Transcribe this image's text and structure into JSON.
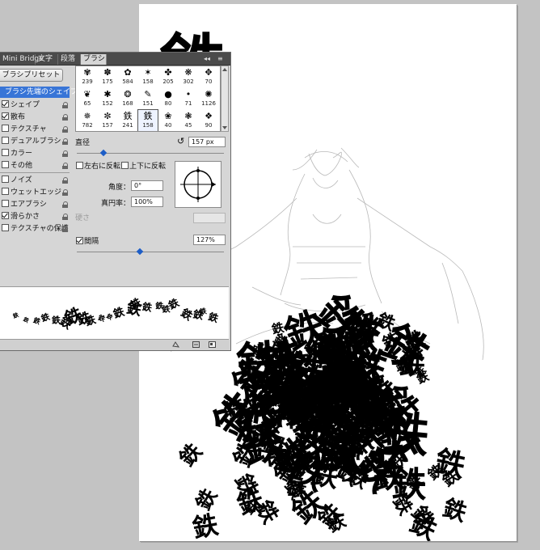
{
  "panel": {
    "tabs": [
      {
        "label": "Mini Bridge",
        "active": false
      },
      {
        "label": "文字",
        "active": false
      },
      {
        "label": "段落",
        "active": false
      },
      {
        "label": "ブラシ",
        "active": true
      }
    ],
    "collapse_icon": "double-chevron-left-icon",
    "menu_icon": "panel-menu-icon",
    "presets_button": "ブラシプリセット",
    "options": [
      {
        "label": "ブラシ先端のシェイプ",
        "checkbox": false,
        "checked": false,
        "selected": true,
        "lock": false
      },
      {
        "label": "シェイプ",
        "checkbox": true,
        "checked": true,
        "selected": false,
        "lock": true
      },
      {
        "label": "散布",
        "checkbox": true,
        "checked": true,
        "selected": false,
        "lock": true
      },
      {
        "label": "テクスチャ",
        "checkbox": true,
        "checked": false,
        "selected": false,
        "lock": true
      },
      {
        "label": "デュアルブラシ",
        "checkbox": true,
        "checked": false,
        "selected": false,
        "lock": true
      },
      {
        "label": "カラー",
        "checkbox": true,
        "checked": false,
        "selected": false,
        "lock": true
      },
      {
        "label": "その他",
        "checkbox": true,
        "checked": false,
        "selected": false,
        "lock": true
      },
      {
        "label": "ノイズ",
        "checkbox": true,
        "checked": false,
        "selected": false,
        "lock": true
      },
      {
        "label": "ウェットエッジ",
        "checkbox": true,
        "checked": false,
        "selected": false,
        "lock": true
      },
      {
        "label": "エアブラシ",
        "checkbox": true,
        "checked": false,
        "selected": false,
        "lock": true
      },
      {
        "label": "滑らかさ",
        "checkbox": true,
        "checked": true,
        "selected": false,
        "lock": true
      },
      {
        "label": "テクスチャの保護",
        "checkbox": true,
        "checked": false,
        "selected": false,
        "lock": true
      }
    ],
    "brush_tips": [
      {
        "glyph": "✾",
        "size": "239"
      },
      {
        "glyph": "✽",
        "size": "175"
      },
      {
        "glyph": "✿",
        "size": "584"
      },
      {
        "glyph": "✶",
        "size": "158"
      },
      {
        "glyph": "✤",
        "size": "205"
      },
      {
        "glyph": "❋",
        "size": "302"
      },
      {
        "glyph": "✥",
        "size": "70"
      },
      {
        "glyph": "❦",
        "size": "65"
      },
      {
        "glyph": "✱",
        "size": "152"
      },
      {
        "glyph": "❂",
        "size": "168"
      },
      {
        "glyph": "✎",
        "size": "151"
      },
      {
        "glyph": "●",
        "size": "80"
      },
      {
        "glyph": "•",
        "size": "71"
      },
      {
        "glyph": "✺",
        "size": "1126"
      },
      {
        "glyph": "✵",
        "size": "782"
      },
      {
        "glyph": "✼",
        "size": "157"
      },
      {
        "glyph": "鉄",
        "size": "241"
      },
      {
        "glyph": "鉄",
        "size": "158"
      },
      {
        "glyph": "❀",
        "size": "40"
      },
      {
        "glyph": "❃",
        "size": "45"
      },
      {
        "glyph": "❖",
        "size": "90"
      }
    ],
    "selected_tip_size": "158",
    "diameter_label": "直径",
    "diameter_value": "157 px",
    "reset_icon": "reset-size-icon",
    "flip_x_label": "左右に反転",
    "flip_y_label": "上下に反転",
    "angle_label": "角度：",
    "angle_value": "0°",
    "roundness_label": "真円率：",
    "roundness_value": "100%",
    "hardness_label": "硬さ",
    "spacing_label": "間隔",
    "spacing_checked": true,
    "spacing_value": "127%",
    "spacing_level_percent": 43,
    "diameter_level_percent": 18,
    "stroke_preview_glyph": "鉄",
    "bottom_icons": [
      "toggle-live-tip-icon",
      "create-new-brush-icon",
      "brush-options-icon"
    ]
  },
  "canvas": {
    "title_glyph": "鉄",
    "pile_glyph": "鉄"
  }
}
